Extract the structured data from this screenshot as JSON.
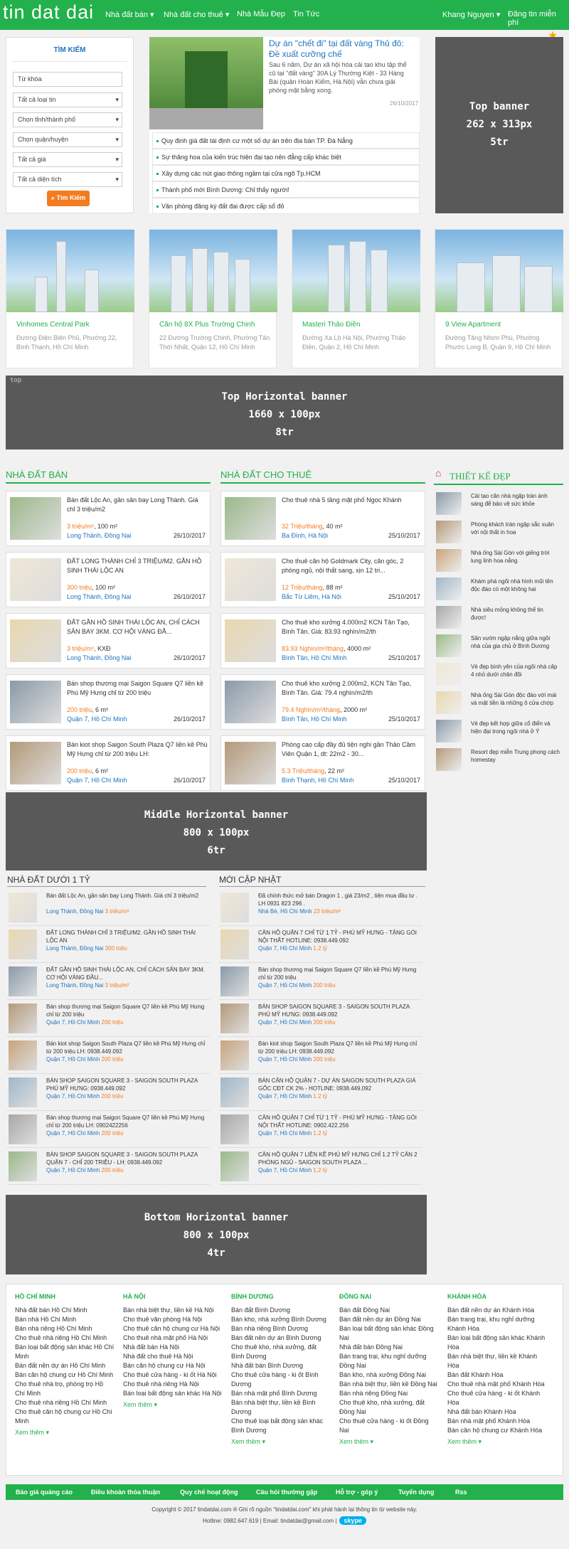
{
  "nav": {
    "logo": "tin dat dai",
    "menu": [
      "Nhà đất bán ▾",
      "Nhà đất cho thuê ▾",
      "Nhà Mẫu Đẹp",
      "Tin Tức"
    ],
    "user": "Khang Nguyen ▾",
    "post": "Đăng tin miễn phí"
  },
  "search": {
    "title": "TÌM KIẾM",
    "keyword_placeholder": "Từ khóa",
    "type": "Tất cả loại tin",
    "province": "Chọn tỉnh/thành phố",
    "district": "Chọn quận/huyện",
    "price": "Tất cả giá",
    "area": "Tất cả diện tích",
    "button": "Tìm Kiếm"
  },
  "featured": {
    "title": "Dự án \"chết đi\" tại đất vàng Thủ đô: Đề xuất cưỡng chế",
    "desc": "Sau 6 năm, Dự án xã hội hóa cải tạo khu tập thể cũ tại \"đất vàng\" 30A Lý Thường Kiệt - 33 Hàng Bài (quận Hoàn Kiếm, Hà Nội) vẫn chưa giải phóng mặt bằng xong.",
    "date": "26/10/2017",
    "bullets": [
      "Quy định giá đất tái định cư một số dự án trên địa bàn TP. Đà Nẵng",
      "Sự thăng hoa của kiến trúc hiện đại tạo nên đẳng cấp khác biệt",
      "Xây dựng các nút giao thông ngầm tại cửa ngõ Tp.HCM",
      "Thành phố mới Bình Dương: Chỉ thấy người!",
      "Văn phòng đăng ký đất đai được cấp sổ đỏ"
    ]
  },
  "banners": {
    "top": [
      "Top banner",
      "262 x 313px",
      "5tr"
    ],
    "horiz": [
      "Top Horizontal banner",
      "1660 x 100px",
      "8tr"
    ],
    "middle": [
      "Middle Horizontal banner",
      "800 x 100px",
      "6tr"
    ],
    "bottom": [
      "Bottom Horizontal banner",
      "800 x 100px",
      "4tr"
    ],
    "label": "top"
  },
  "projects": [
    {
      "name": "Vinhomes Central Park",
      "addr": "Đường Điện Biên Phủ, Phường 22, Bình Thạnh, Hồ Chí Minh"
    },
    {
      "name": "Căn hộ 8X Plus Trường Chinh",
      "addr": "22 Đường Trường Chinh, Phường Tân Thới Nhất, Quận 12, Hồ Chí Minh"
    },
    {
      "name": "Masteri Thảo Điền",
      "addr": "Đường Xa Lộ Hà Nội, Phường Thảo Điền, Quận 2, Hồ Chí Minh"
    },
    {
      "name": "9 View Apartment",
      "addr": "Đường Tăng Nhơn Phú, Phường Phước Long B, Quận 9, Hồ Chí Minh"
    }
  ],
  "sections": {
    "sale": "NHÀ ĐẤT BÁN",
    "rent": "NHÀ ĐẤT CHO THUÊ",
    "design": "THIẾT KẾ ĐẸP",
    "under": "NHÀ ĐẤT DƯỚI 1 TỶ",
    "new": "MỚI CẬP NHẬT"
  },
  "sale": [
    {
      "title": "Bán đất Lộc An, gần sân bay Long Thành. Giá chỉ 3 triệu/m2",
      "price": "3 triệu/m²",
      "area": ", 100 m²",
      "loc": "Long Thành, Đồng Nai",
      "date": "26/10/2017"
    },
    {
      "title": "ĐẤT LONG THÀNH CHỈ 3 TRIỆU/M2. GẦN HỒ SINH THÁI LỘC AN",
      "price": "300 triệu",
      "area": ", 100 m²",
      "loc": "Long Thành, Đồng Nai",
      "date": "26/10/2017"
    },
    {
      "title": "ĐẤT GẦN HỒ SINH THÁI LỘC AN, CHỈ CÁCH SÂN BAY 3KM. CƠ HỘI VÀNG ĐẦ...",
      "price": "3 triệu/m²",
      "area": ", KXĐ",
      "loc": "Long Thành, Đồng Nai",
      "date": "26/10/2017"
    },
    {
      "title": "Bán shop thương mại Saigon Square Q7 liền kề Phú Mỹ Hưng chỉ từ 200 triệu",
      "price": "200 triệu",
      "area": ", 6 m²",
      "loc": "Quận 7, Hồ Chí Minh",
      "date": "26/10/2017"
    },
    {
      "title": "Bán kiot shop Saigon South Plaza Q7 liền kề Phú Mỹ Hưng chỉ từ 200 triệu LH:",
      "price": "200 triệu",
      "area": ", 6 m²",
      "loc": "Quận 7, Hồ Chí Minh",
      "date": "26/10/2017"
    }
  ],
  "rent": [
    {
      "title": "Cho thuê nhà 5 tầng mặt phố Ngọc Khánh",
      "price": "32 Triệu/tháng",
      "area": ", 40 m²",
      "loc": "Ba Đình, Hà Nội",
      "date": "25/10/2017"
    },
    {
      "title": "Cho thuê căn hộ Goldmark City, căn góc, 2 phòng ngủ, nội thất sang, xịn 12 tri...",
      "price": "12 Triệu/tháng",
      "area": ", 88 m²",
      "loc": "Bắc Từ Liêm, Hà Nội",
      "date": "25/10/2017"
    },
    {
      "title": "Cho thuê kho xưởng 4.000m2 KCN Tân Tạo, Bình Tân. Giá: 83.93 nghìn/m2/th",
      "price": "83.93 Nghìn/m²/tháng",
      "area": ", 4000 m²",
      "loc": "Bình Tân, Hồ Chí Minh",
      "date": "25/10/2017"
    },
    {
      "title": "Cho thuê kho xưởng 2.000m2, KCN Tân Tạo, Bình Tân. Giá: 79.4 nghìn/m2/th",
      "price": "79.4 Nghìn/m²/tháng",
      "area": ", 2000 m²",
      "loc": "Bình Tân, Hồ Chí Minh",
      "date": "25/10/2017"
    },
    {
      "title": "Phòng cao cấp đầy đủ tiện nghi gần Thảo Cầm Viên Quận 1, dt: 22m2 - 30...",
      "price": "5.3 Triệu/tháng",
      "area": ", 22 m²",
      "loc": "Bình Thạnh, Hồ Chí Minh",
      "date": "25/10/2017"
    }
  ],
  "design": [
    "Cải tạo căn nhà ngập tràn ánh sáng để bảo vệ sức khỏe",
    "Phòng khách tràn ngập sắc xuân với nội thất in hoa",
    "Nhà ống Sài Gòn với giếng trời lung linh hoa nắng",
    "Khám phá ngôi nhà hình mũi tên độc đáo có một không hai",
    "Nhà siêu mỏng không thể tin được!",
    "Sân vườn ngập nắng giữa ngôi nhà của gia chủ ở Bình Dương",
    "Vẻ đẹp bình yên của ngôi nhà cấp 4 nhỏ dưới chân đồi",
    "Nhà ống Sài Gòn độc đáo với mái và mặt tiền là những ô cửa chớp",
    "Vẻ đẹp kết hợp giữa cổ điển và hiện đại trong ngôi nhà ở Ý",
    "Resort đẹp miễn Trung phong cách homestay"
  ],
  "under": [
    {
      "title": "Bán đất Lộc An, gần sân bay Long Thành. Giá chỉ 3 triệu/m2",
      "loc": "Long Thành, Đồng Nai",
      "price": "3 triệu/m²"
    },
    {
      "title": "ĐẤT LONG THÀNH CHỈ 3 TRIỆU/M2. GẦN HỒ SINH THÁI LỘC AN",
      "loc": "Long Thành, Đồng Nai",
      "price": "300 triệu"
    },
    {
      "title": "ĐẤT GẦN HỒ SINH THÁI LỘC AN, CHỈ CÁCH SÂN BAY 3KM. CƠ HỘI VÀNG ĐẦU...",
      "loc": "Long Thành, Đồng Nai",
      "price": "3 triệu/m²"
    },
    {
      "title": "Bán shop thương mại Saigon Square Q7 liền kề Phú Mỹ Hưng chỉ từ 200 triệu",
      "loc": "Quận 7, Hồ Chí Minh",
      "price": "200 triệu"
    },
    {
      "title": "Bán kiot shop Saigon South Plaza Q7 liền kề Phú Mỹ Hưng chỉ từ 200 triệu LH: 0938.449.092",
      "loc": "Quận 7, Hồ Chí Minh",
      "price": "200 triệu"
    },
    {
      "title": "BÁN SHOP SAIGON SQUARE 3 - SAIGON SOUTH PLAZA PHÚ MỸ HƯNG: 0938.449.092",
      "loc": "Quận 7, Hồ Chí Minh",
      "price": "200 triệu"
    },
    {
      "title": "Bán shop thương mại Saigon Square Q7 liền kề Phú Mỹ Hưng chỉ từ 200 triệu LH: 0902422256",
      "loc": "Quận 7, Hồ Chí Minh",
      "price": "200 triệu"
    },
    {
      "title": "BÁN SHOP SAIGON SQUARE 3 - SAIGON SOUTH PLAZA QUẬN 7 - CHỈ 200 TRIỆU - LH: 0938.449.092",
      "loc": "Quận 7, Hồ Chí Minh",
      "price": "200 triệu"
    }
  ],
  "new": [
    {
      "title": "Đã chính thức mở bán Dragon 1 , giá 23/m2 , tiện mua đầu tư . LH 0931 823 296 .",
      "loc": "Nhà Bè, Hồ Chí Minh",
      "price": "23 triệu/m²"
    },
    {
      "title": "CĂN HỘ QUẬN 7 CHỈ TỪ 1 TỶ - PHÚ MỸ HƯNG - TẶNG GÓI NỘI THẤT HOTLINE: 0938.449.092",
      "loc": "Quận 7, Hồ Chí Minh",
      "price": "1.2 tỷ"
    },
    {
      "title": "Bán shop thương mại Saigon Square Q7 liền kề Phú Mỹ Hưng chỉ từ 200 triệu",
      "loc": "Quận 7, Hồ Chí Minh",
      "price": "200 triệu"
    },
    {
      "title": "BÁN SHOP SAIGON SQUARE 3 - SAIGON SOUTH PLAZA PHÚ MỸ HƯNG: 0938.449.092",
      "loc": "Quận 7, Hồ Chí Minh",
      "price": "200 triệu"
    },
    {
      "title": "Bán kiot shop Saigon South Plaza Q7 liền kề Phú Mỹ Hưng chỉ từ 200 triệu LH: 0938.449.092",
      "loc": "Quận 7, Hồ Chí Minh",
      "price": "200 triệu"
    },
    {
      "title": "BÁN CĂN HỘ QUẬN 7 - DỰ ÁN SAIGON SOUTH PLAZA GIÁ GỐC CĐT CK 2% - HOTLINE: 0938.449.092",
      "loc": "Quận 7, Hồ Chí Minh",
      "price": "1.2 tỷ"
    },
    {
      "title": "CĂN HỘ QUẬN 7 CHỈ TỪ 1 TỶ - PHÚ MỸ HƯNG - TẶNG GÓI NỘI THẤT HOTLINE: 0902.422.256",
      "loc": "Quận 7, Hồ Chí Minh",
      "price": "1.2 tỷ"
    },
    {
      "title": "CĂN HỘ QUẬN 7 LIỀN KỀ PHÚ MỸ HƯNG CHỈ 1.2 TỶ CĂN 2 PHÒNG NGỦ - SAIGON SOUTH PLAZA ...",
      "loc": "Quận 7, Hồ Chí Minh",
      "price": "1.2 tỷ"
    }
  ],
  "footer": {
    "more": "Xem thêm ▾",
    "cols": [
      {
        "head": "HỒ CHÍ MINH",
        "links": [
          "Nhà đất bán Hồ Chí Minh",
          "Bán nhà Hồ Chí Minh",
          "Bán nhà riêng Hồ Chí Minh",
          "Cho thuê nhà riêng Hồ Chí Minh",
          "Bán loại bất động sản khác Hồ Chí Minh",
          "Bán đất nền dự án Hồ Chí Minh",
          "Bán căn hộ chung cư Hồ Chí Minh",
          "Cho thuê nhà trọ, phòng trọ Hồ Chí Minh",
          "Cho thuê nhà riêng Hồ Chí Minh",
          "Cho thuê căn hộ chung cư Hồ Chí Minh"
        ]
      },
      {
        "head": "HÀ NỘI",
        "links": [
          "Bán nhà biệt thự, liền kề Hà Nội",
          "Cho thuê văn phòng Hà Nội",
          "Cho thuê căn hộ chung cư Hà Nội",
          "Cho thuê nhà mặt phố Hà Nội",
          "Nhà đất bán Hà Nội",
          "Nhà đất cho thuê Hà Nội",
          "Bán căn hộ chung cư Hà Nội",
          "Cho thuê cửa hàng - ki ốt Hà Nội",
          "Cho thuê nhà riêng Hà Nội",
          "Bán loại bất động sản khác Hà Nội"
        ]
      },
      {
        "head": "BÌNH DƯƠNG",
        "links": [
          "Bán đất Bình Dương",
          "Bán kho, nhà xưởng Bình Dương",
          "Bán nhà riêng Bình Dương",
          "Bán đất nền dự án Bình Dương",
          "Cho thuê kho, nhà xưởng, đất Bình Dương",
          "Nhà đất bán Bình Dương",
          "Cho thuê cửa hàng - ki ốt Bình Dương",
          "Bán nhà mặt phố Bình Dương",
          "Bán nhà biệt thự, liền kề Bình Dương",
          "Cho thuê loại bất động sản khác Bình Dương"
        ]
      },
      {
        "head": "ĐỒNG NAI",
        "links": [
          "Bán đất Đồng Nai",
          "Bán đất nền dự án Đồng Nai",
          "Bán loại bất động sản khác Đồng Nai",
          "Nhà đất bán Đồng Nai",
          "Bán trang trại, khu nghỉ dưỡng Đồng Nai",
          "Bán kho, nhà xưởng Đồng Nai",
          "Bán nhà biệt thự, liền kề Đồng Nai",
          "Bán nhà riêng Đồng Nai",
          "Cho thuê kho, nhà xưởng, đất Đồng Nai",
          "Cho thuê cửa hàng - ki ốt Đồng Nai"
        ]
      },
      {
        "head": "KHÁNH HÒA",
        "links": [
          "Bán đất nền dự án Khánh Hòa",
          "Bán trang trại, khu nghỉ dưỡng Khánh Hòa",
          "Bán loại bất động sản khác Khánh Hòa",
          "Bán nhà biệt thự, liền kề Khánh Hòa",
          "Bán đất Khánh Hòa",
          "Cho thuê nhà mặt phố Khánh Hòa",
          "Cho thuê cửa hàng - ki ốt Khánh Hòa",
          "Nhà đất bán Khánh Hòa",
          "Bán nhà mặt phố Khánh Hòa",
          "Bán căn hộ chung cư Khánh Hòa"
        ]
      }
    ]
  },
  "bottom_nav": [
    "Báo giá quảng cáo",
    "Điều khoản thỏa thuận",
    "Quy chế hoạt động",
    "Câu hỏi thường gặp",
    "Hỗ trợ - góp ý",
    "Tuyển dụng",
    "Rss"
  ],
  "copyright": "Copyright © 2017 tindatdai.com ® Ghi rõ nguồn \"tindatdai.com\" khi phát hành lại thông tin từ website này.",
  "contact": "Hotline: 0982.647.619 | Email: tindatdai@gmail.com |",
  "skype": "skype",
  "colors": {
    "brand": "#22b14c",
    "accent": "#f47b20",
    "link": "#1e73be",
    "banner": "#595959"
  }
}
